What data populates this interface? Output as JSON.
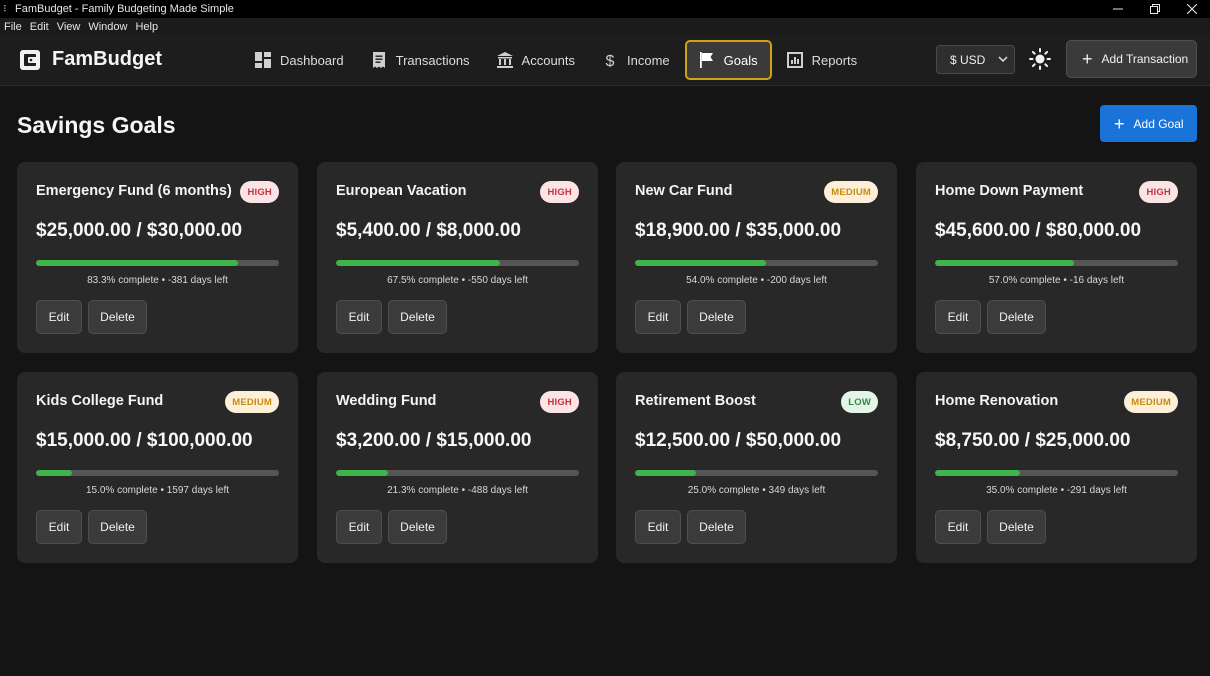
{
  "window": {
    "title": "FamBudget - Family Budgeting Made Simple"
  },
  "menu": [
    "File",
    "Edit",
    "View",
    "Window",
    "Help"
  ],
  "header": {
    "brand": "FamBudget",
    "nav": [
      {
        "label": "Dashboard",
        "icon": "dashboard-icon",
        "active": false
      },
      {
        "label": "Transactions",
        "icon": "receipt-icon",
        "active": false
      },
      {
        "label": "Accounts",
        "icon": "bank-icon",
        "active": false
      },
      {
        "label": "Income",
        "icon": "dollar-icon",
        "active": false
      },
      {
        "label": "Goals",
        "icon": "flag-icon",
        "active": true
      },
      {
        "label": "Reports",
        "icon": "bar-chart-icon",
        "active": false
      }
    ],
    "currency": "$ USD",
    "add_transaction": "Add Transaction"
  },
  "main": {
    "title": "Savings Goals",
    "add_goal": "Add Goal",
    "edit_label": "Edit",
    "delete_label": "Delete",
    "goals": [
      {
        "name": "Emergency Fund (6 months)",
        "priority": "HIGH",
        "amount": "$25,000.00 / $30,000.00",
        "progress": 83.3,
        "status": "83.3% complete • -381 days left"
      },
      {
        "name": "European Vacation",
        "priority": "HIGH",
        "amount": "$5,400.00 / $8,000.00",
        "progress": 67.5,
        "status": "67.5% complete • -550 days left"
      },
      {
        "name": "New Car Fund",
        "priority": "MEDIUM",
        "amount": "$18,900.00 / $35,000.00",
        "progress": 54.0,
        "status": "54.0% complete • -200 days left"
      },
      {
        "name": "Home Down Payment",
        "priority": "HIGH",
        "amount": "$45,600.00 / $80,000.00",
        "progress": 57.0,
        "status": "57.0% complete • -16 days left"
      },
      {
        "name": "Kids College Fund",
        "priority": "MEDIUM",
        "amount": "$15,000.00 / $100,000.00",
        "progress": 15.0,
        "status": "15.0% complete • 1597 days left"
      },
      {
        "name": "Wedding Fund",
        "priority": "HIGH",
        "amount": "$3,200.00 / $15,000.00",
        "progress": 21.3,
        "status": "21.3% complete • -488 days left"
      },
      {
        "name": "Retirement Boost",
        "priority": "LOW",
        "amount": "$12,500.00 / $50,000.00",
        "progress": 25.0,
        "status": "25.0% complete • 349 days left"
      },
      {
        "name": "Home Renovation",
        "priority": "MEDIUM",
        "amount": "$8,750.00 / $25,000.00",
        "progress": 35.0,
        "status": "35.0% complete • -291 days left"
      }
    ]
  },
  "colors": {
    "accent_active_border": "#d4a017",
    "primary_button": "#1a73d9",
    "progress_fill": "#3fb44a",
    "badge_high_text": "#c0353d",
    "badge_medium_text": "#c98a12",
    "badge_low_text": "#2f8a43"
  }
}
